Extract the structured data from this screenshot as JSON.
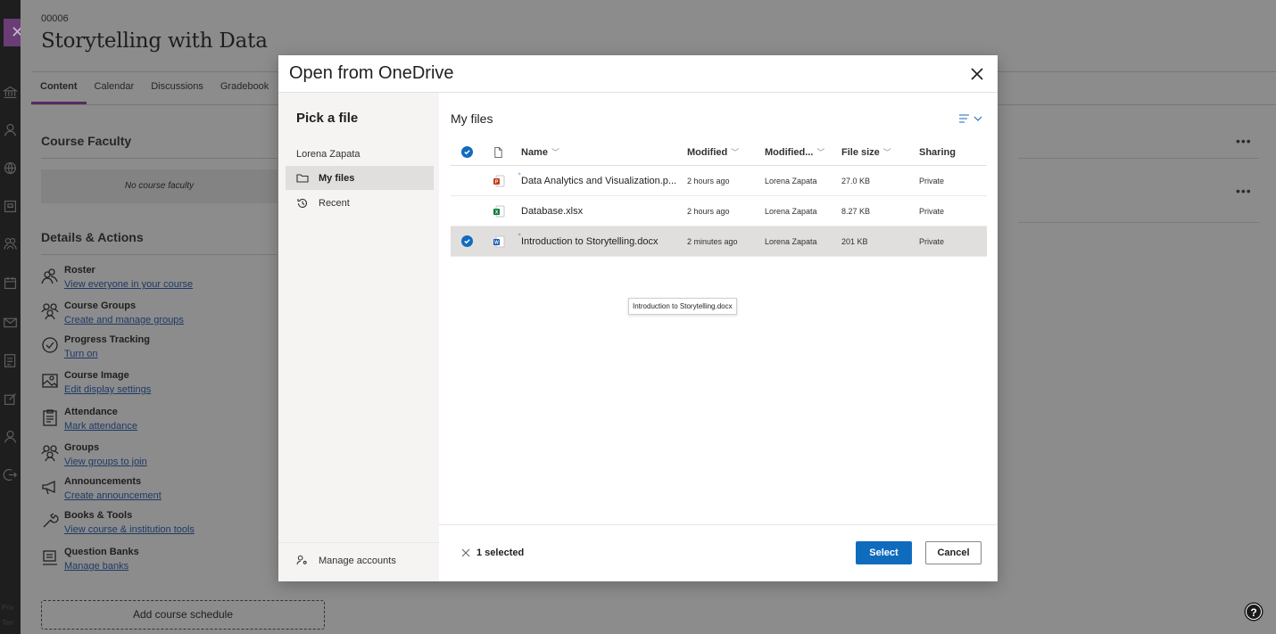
{
  "course": {
    "id": "00006",
    "title": "Storytelling with Data",
    "tabs": [
      "Content",
      "Calendar",
      "Discussions",
      "Gradebook"
    ]
  },
  "left_rail": {
    "legal_1": "Priv",
    "legal_2": "Terr"
  },
  "course_faculty": {
    "title": "Course Faculty",
    "empty_text": "No course faculty"
  },
  "details": {
    "title": "Details & Actions",
    "items": [
      {
        "title": "Roster",
        "link": "View everyone in your course",
        "icon": "people-icon"
      },
      {
        "title": "Course Groups",
        "link": "Create and manage groups",
        "icon": "group-icon"
      },
      {
        "title": "Progress Tracking",
        "link": "Turn on",
        "icon": "check-circle-icon"
      },
      {
        "title": "Course Image",
        "link": "Edit display settings",
        "icon": "image-icon"
      },
      {
        "title": "Attendance",
        "link": "Mark attendance",
        "icon": "clipboard-icon"
      },
      {
        "title": "Groups",
        "link": "View groups to join",
        "icon": "group-icon"
      },
      {
        "title": "Announcements",
        "link": "Create announcement",
        "icon": "megaphone-icon"
      },
      {
        "title": "Books & Tools",
        "link": "View course & institution tools",
        "icon": "wrench-icon"
      },
      {
        "title": "Question Banks",
        "link": "Manage banks",
        "icon": "bank-icon"
      }
    ]
  },
  "schedule_button": "Add course schedule",
  "dialog": {
    "title": "Open from OneDrive",
    "nav": {
      "title": "Pick a file",
      "account": "Lorena Zapata",
      "items": [
        {
          "label": "My files",
          "icon": "folder-icon",
          "selected": true
        },
        {
          "label": "Recent",
          "icon": "history-icon",
          "selected": false
        }
      ],
      "manage_accounts": "Manage accounts"
    },
    "main": {
      "title": "My files",
      "columns": {
        "name": "Name",
        "modified": "Modified",
        "modified_by": "Modified...",
        "file_size": "File size",
        "sharing": "Sharing"
      },
      "files": [
        {
          "name": "Data Analytics and Visualization.p...",
          "type": "powerpoint",
          "modified": "2 hours ago",
          "modified_by": "Lorena Zapata",
          "size": "27.0 KB",
          "sharing": "Private",
          "new": true,
          "selected": false
        },
        {
          "name": "Database.xlsx",
          "type": "excel",
          "modified": "2 hours ago",
          "modified_by": "Lorena Zapata",
          "size": "8.27 KB",
          "sharing": "Private",
          "new": false,
          "selected": false
        },
        {
          "name": "Introduction to Storytelling.docx",
          "type": "word",
          "modified": "2 minutes ago",
          "modified_by": "Lorena Zapata",
          "size": "201 KB",
          "sharing": "Private",
          "new": true,
          "selected": true
        }
      ],
      "tooltip": "Introduction to Storytelling.docx",
      "selected_count": "1 selected",
      "select_label": "Select",
      "cancel_label": "Cancel"
    }
  },
  "colors": {
    "accent": "#0f6cbd",
    "course_purple": "#5a2a64",
    "powerpoint": "#c43e1c",
    "excel": "#107c41",
    "word": "#185abd"
  }
}
